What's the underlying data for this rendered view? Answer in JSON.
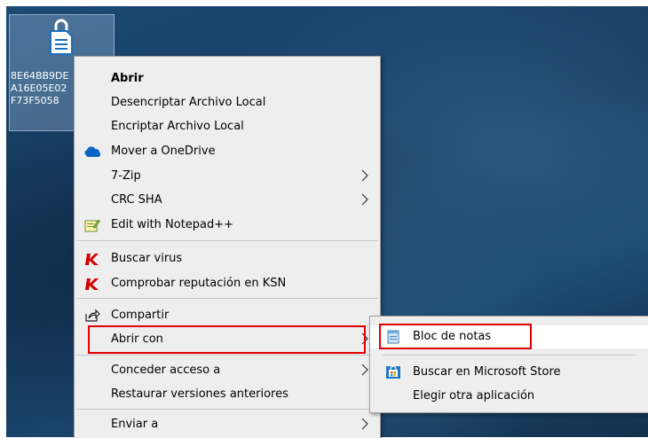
{
  "desktop_file": {
    "name_lines": [
      "8E64BB9DE",
      "A16E05E02",
      "F73F5058"
    ]
  },
  "context_menu": {
    "items": [
      {
        "label": "Abrir"
      },
      {
        "label": "Desencriptar Archivo Local"
      },
      {
        "label": "Encriptar Archivo Local"
      },
      {
        "label": "Mover a OneDrive",
        "icon": "onedrive-icon"
      },
      {
        "label": "7-Zip"
      },
      {
        "label": "CRC SHA"
      },
      {
        "label": "Edit with Notepad++",
        "icon": "notepadpp-icon"
      },
      {
        "label": "Buscar virus",
        "icon": "kaspersky-icon"
      },
      {
        "label": "Comprobar reputación en KSN",
        "icon": "kaspersky-icon"
      },
      {
        "label": "Compartir",
        "icon": "share-icon"
      },
      {
        "label": "Abrir con"
      },
      {
        "label": "Conceder acceso a"
      },
      {
        "label": "Restaurar versiones anteriores"
      },
      {
        "label": "Enviar a"
      }
    ]
  },
  "open_with_submenu": {
    "items": [
      {
        "label": "Bloc de notas",
        "icon": "notepad-icon"
      },
      {
        "label": "Buscar en Microsoft Store",
        "icon": "store-icon"
      },
      {
        "label": "Elegir otra aplicación"
      }
    ]
  },
  "colors": {
    "highlight_box": "#e00000",
    "menu_background": "#eeeeee",
    "onedrive_blue": "#0a64c8",
    "kaspersky_red": "#d40000"
  }
}
